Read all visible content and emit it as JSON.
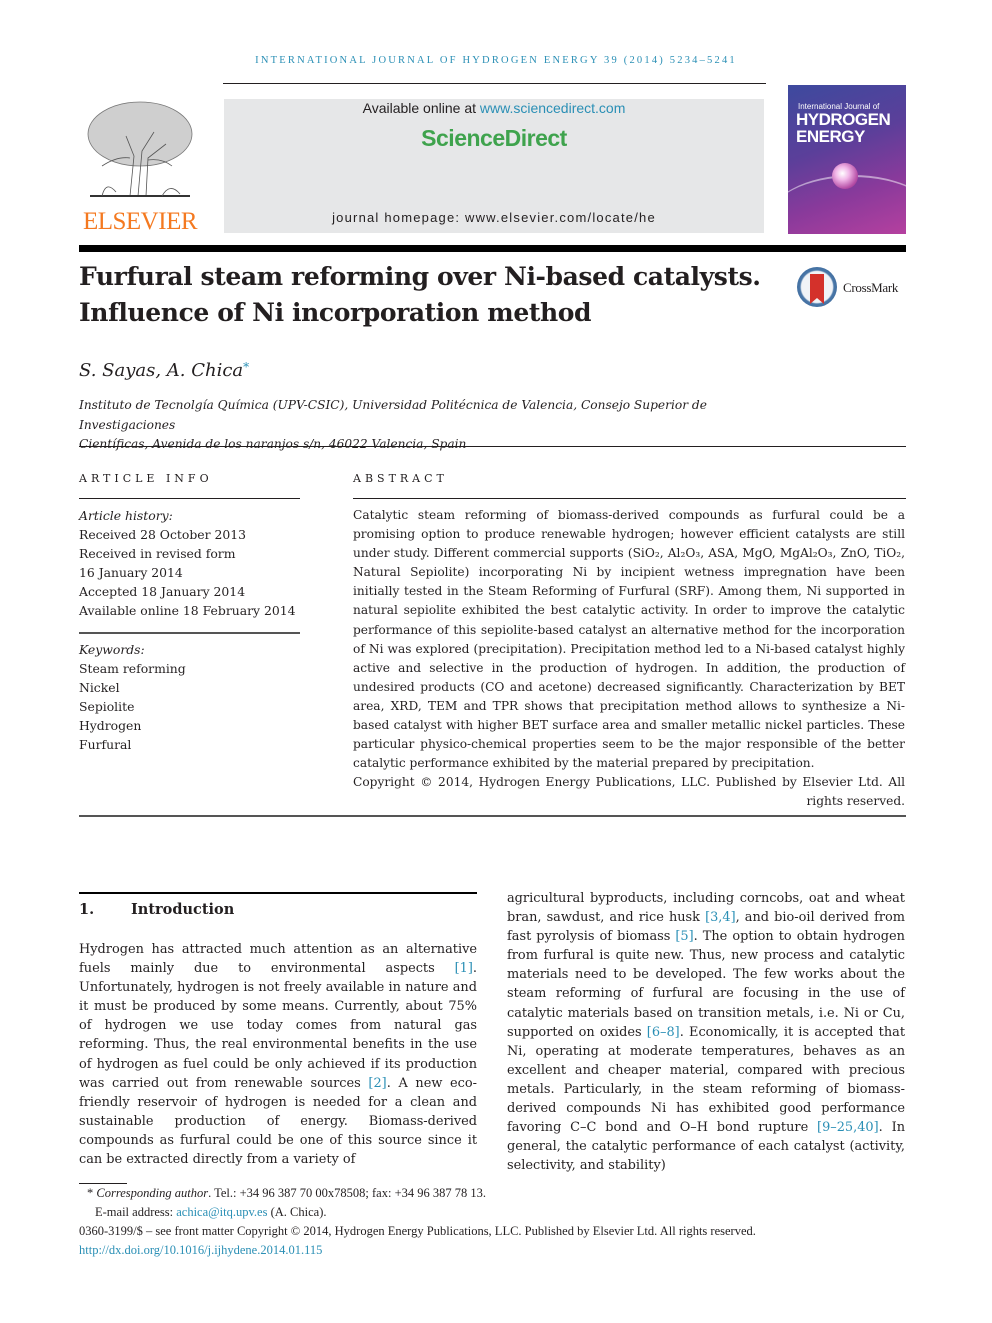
{
  "running_head": "INTERNATIONAL JOURNAL OF HYDROGEN ENERGY 39 (2014) 5234–5241",
  "header": {
    "publisher_logo_text": "ELSEVIER",
    "available_prefix": "Available online at ",
    "available_link": "www.sciencedirect.com",
    "brand": "ScienceDirect",
    "homepage": "journal homepage: www.elsevier.com/locate/he",
    "cover": {
      "line1": "International Journal of",
      "line2": "HYDROGEN",
      "line3": "ENERGY"
    },
    "colors": {
      "link": "#2a8fb5",
      "brand_green": "#3fa34d",
      "elsevier_orange": "#f47920"
    }
  },
  "article": {
    "title_line1": "Furfural steam reforming over Ni-based catalysts.",
    "title_line2": "Influence of Ni incorporation method",
    "crossmark_label": "CrossMark",
    "authors": "S. Sayas, A. Chica",
    "author_mark": "*",
    "affiliation_line1": "Instituto de Tecnolgía Química (UPV-CSIC), Universidad Politécnica de Valencia, Consejo Superior de Investigaciones",
    "affiliation_line2": "Científicas, Avenida de los naranjos s/n, 46022 Valencia, Spain"
  },
  "article_info": {
    "heading": "ARTICLE INFO",
    "history_label": "Article history:",
    "history": [
      "Received 28 October 2013",
      "Received in revised form",
      "16 January 2014",
      "Accepted 18 January 2014",
      "Available online 18 February 2014"
    ],
    "keywords_label": "Keywords:",
    "keywords": [
      "Steam reforming",
      "Nickel",
      "Sepiolite",
      "Hydrogen",
      "Furfural"
    ]
  },
  "abstract": {
    "heading": "ABSTRACT",
    "p1": "Catalytic steam reforming of biomass-derived compounds as furfural could be a promising option to produce renewable hydrogen; however efficient catalysts are still under study. Different commercial supports (SiO₂, Al₂O₃, ASA, MgO, MgAl₂O₃, ZnO, TiO₂, Natural Sepiolite) incorporating Ni by incipient wetness impregnation have been initially tested in the Steam Reforming of Furfural (SRF). Among them, Ni supported in natural sepiolite exhibited the best catalytic activity. In order to improve the catalytic performance of this sepiolite-based catalyst an alternative method for the incorporation of Ni was explored (precipitation). Precipitation method led to a Ni-based catalyst highly active and selective in the production of hydrogen. In addition, the production of undesired products (CO and acetone) decreased significantly. Characterization by BET area, XRD, TEM and TPR shows that precipitation method allows to synthesize a Ni-based catalyst with higher BET surface area and smaller metallic nickel particles. These particular physico-chemical properties seem to be the major responsible of the better catalytic performance exhibited by the material prepared by precipitation.",
    "copyright": "Copyright © 2014, Hydrogen Energy Publications, LLC. Published by Elsevier Ltd. All rights reserved."
  },
  "intro": {
    "number": "1.",
    "title": "Introduction",
    "left": [
      {
        "t": "Hydrogen has attracted much attention as an alternative fuels mainly due to environmental aspects "
      },
      {
        "ref": "[1]"
      },
      {
        "t": ". Unfortunately, hydrogen is not freely available in nature and it must be produced by some means. Currently, about 75% of hydrogen we use today comes from natural gas reforming. Thus, the real environmental benefits in the use of hydrogen as fuel could be only achieved if its production was carried out from renewable sources "
      },
      {
        "ref": "[2]"
      },
      {
        "t": ". A new eco-friendly reservoir of hydrogen is needed for a clean and sustainable production of energy. Biomass-derived compounds as furfural could be one of this source since it can be extracted directly from a variety of"
      }
    ],
    "right": [
      {
        "t": "agricultural byproducts, including corncobs, oat and wheat bran, sawdust, and rice husk "
      },
      {
        "ref": "[3,4]"
      },
      {
        "t": ", and bio-oil derived from fast pyrolysis of biomass "
      },
      {
        "ref": "[5]"
      },
      {
        "t": ". The option to obtain hydrogen from furfural is quite new. Thus, new process and catalytic materials need to be developed. The few works about the steam reforming of furfural are focusing in the use of catalytic materials based on transition metals, i.e. Ni or Cu, supported on oxides "
      },
      {
        "ref": "[6–8]"
      },
      {
        "t": ". Economically, it is accepted that Ni, operating at moderate temperatures, behaves as an excellent and cheaper material, compared with precious metals. Particularly, in the steam reforming of biomass-derived compounds Ni has exhibited good performance favoring C–C bond and O–H bond rupture "
      },
      {
        "ref": "[9–25,40]"
      },
      {
        "t": ". In general, the catalytic performance of each catalyst (activity, selectivity, and stability)"
      }
    ]
  },
  "footnotes": {
    "mark": "*",
    "corresponding_label": "Corresponding author",
    "contact": ". Tel.: +34 96 387 70 00x78508; fax: +34 96 387 78 13.",
    "email_label": "E-mail address: ",
    "email": "achica@itq.upv.es",
    "email_suffix": " (A. Chica).",
    "front_matter": "0360-3199/$ – see front matter Copyright © 2014, Hydrogen Energy Publications, LLC. Published by Elsevier Ltd. All rights reserved.",
    "doi": "http://dx.doi.org/10.1016/j.ijhydene.2014.01.115"
  }
}
